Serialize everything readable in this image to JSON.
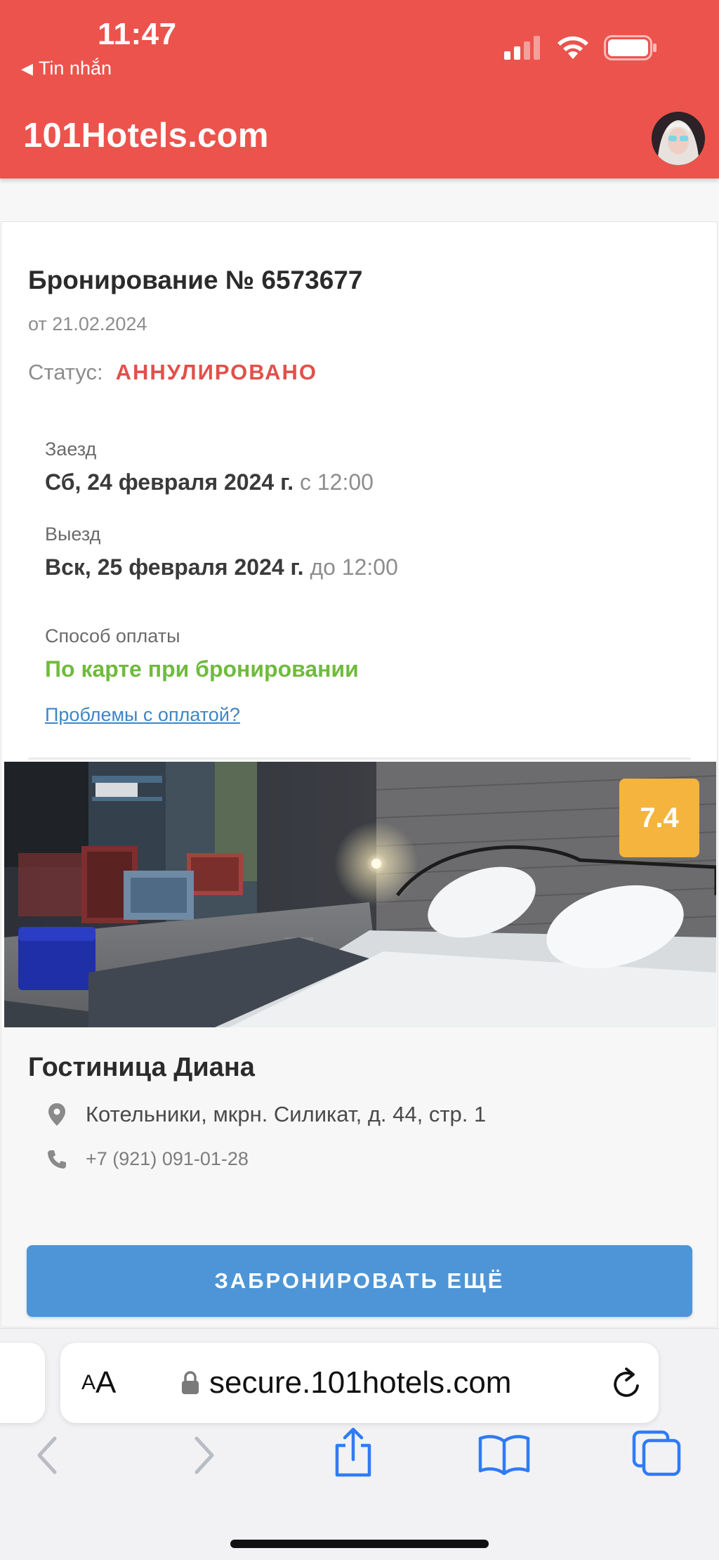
{
  "status_bar": {
    "time": "11:47",
    "back_app": "Tin nhắn"
  },
  "header": {
    "site_name": "101Hotels.com"
  },
  "booking": {
    "title": "Бронирование № 6573677",
    "date": "от 21.02.2024",
    "status_label": "Статус:",
    "status_value": "АННУЛИРОВАНО",
    "checkin_label": "Заезд",
    "checkin_date": "Сб, 24 февраля 2024 г.",
    "checkin_time": "с 12:00",
    "checkout_label": "Выезд",
    "checkout_date": "Вск, 25 февраля 2024 г.",
    "checkout_time": "до 12:00",
    "payment_label": "Способ оплаты",
    "payment_value": "По карте при бронировании",
    "payment_problem_link": "Проблемы с оплатой?"
  },
  "hotel": {
    "rating": "7.4",
    "name": "Гостиница Диана",
    "address": "Котельники, мкрн. Силикат, д. 44, стр. 1",
    "phone": "+7 (921) 091-01-28"
  },
  "actions": {
    "book_again": "ЗАБРОНИРОВАТЬ ЕЩЁ"
  },
  "browser": {
    "aa_small": "A",
    "aa_large": "A",
    "url": "secure.101hotels.com"
  },
  "colors": {
    "header_bg": "#ec534c",
    "status_cancelled": "#e2504a",
    "payment_green": "#6fbb3c",
    "link_blue": "#3f86c5",
    "rating_badge": "#f4b43d",
    "button_blue": "#4d95d6",
    "ios_blue": "#2f7bf6"
  },
  "icons": {
    "back": "back-arrow-icon",
    "signal": "signal-bars-icon",
    "wifi": "wifi-icon",
    "battery": "battery-icon",
    "location": "location-pin-icon",
    "phone": "phone-icon",
    "lock": "lock-icon",
    "reload": "reload-icon",
    "nav_back": "chevron-left-icon",
    "nav_forward": "chevron-right-icon",
    "share": "share-icon",
    "bookmarks": "book-icon",
    "tabs": "tabs-icon"
  }
}
